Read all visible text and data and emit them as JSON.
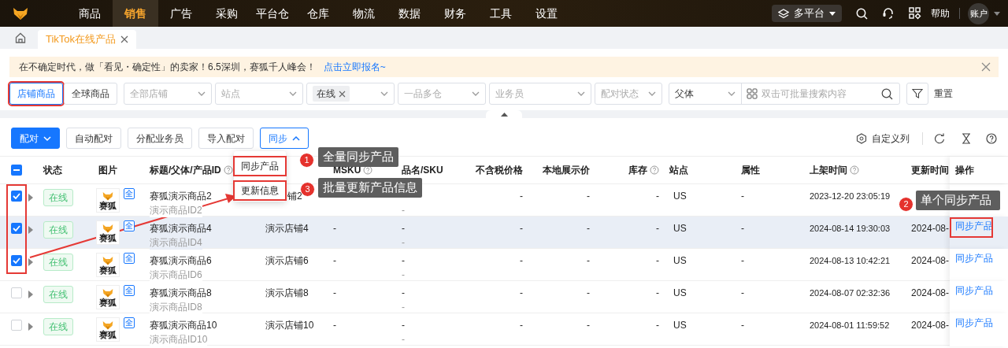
{
  "nav": {
    "items": [
      {
        "label": "商品",
        "selected": false
      },
      {
        "label": "销售",
        "selected": true
      },
      {
        "label": "广告",
        "selected": false
      },
      {
        "label": "采购",
        "selected": false
      },
      {
        "label": "平台仓",
        "selected": false
      },
      {
        "label": "仓库",
        "selected": false
      },
      {
        "label": "物流",
        "selected": false
      },
      {
        "label": "数据",
        "selected": false
      },
      {
        "label": "财务",
        "selected": false
      },
      {
        "label": "工具",
        "selected": false
      },
      {
        "label": "设置",
        "selected": false
      }
    ],
    "platform": "多平台",
    "help": "帮助",
    "account": "账户"
  },
  "tabs": [
    {
      "label": "TikTok在线产品",
      "selected": true
    }
  ],
  "banner": {
    "text": "在不确定时代，做「看见・确定性」的卖家！6.5深圳，赛狐千人峰会！",
    "link": "点击立即报名~"
  },
  "scope_buttons": [
    {
      "label": "店铺商品",
      "selected": true
    },
    {
      "label": "全球商品",
      "selected": false
    }
  ],
  "filters": [
    {
      "kind": "select",
      "placeholder": "全部店铺"
    },
    {
      "kind": "select",
      "placeholder": "站点"
    },
    {
      "kind": "tag",
      "tag": "在线"
    },
    {
      "kind": "select",
      "placeholder": "一品多仓"
    },
    {
      "kind": "select",
      "placeholder": "业务员"
    },
    {
      "kind": "select",
      "placeholder": "配对状态"
    },
    {
      "kind": "search",
      "value": "父体",
      "placeholder": "双击可批量搜索内容"
    }
  ],
  "reset": "重置",
  "toolbar": {
    "buttons": [
      {
        "label": "配对",
        "kind": "primary"
      },
      {
        "label": "自动配对",
        "kind": "plain"
      },
      {
        "label": "分配业务员",
        "kind": "plain"
      },
      {
        "label": "导入配对",
        "kind": "plain"
      },
      {
        "label": "同步",
        "kind": "open"
      }
    ],
    "custom_columns": "自定义列"
  },
  "sync_menu": [
    "同步产品",
    "更新信息"
  ],
  "table": {
    "select_all": {
      "indeterminate": true
    },
    "columns": [
      {
        "label": "状态"
      },
      {
        "label": "图片"
      },
      {
        "label": "标题/父体/产品ID",
        "help": true
      },
      {},
      {
        "label": "MSKU",
        "help": true
      },
      {
        "label": "品名/SKU"
      },
      {
        "label": "不含税价格"
      },
      {
        "label": "本地展示价"
      },
      {
        "label": "库存",
        "help": true
      },
      {
        "label": "站点"
      },
      {
        "label": "属性"
      },
      {
        "label": "上架时间",
        "help": true
      },
      {
        "label": "更新时间"
      },
      {
        "label": "操作"
      }
    ],
    "rows": [
      {
        "checked": true,
        "highlighted": false,
        "status": "在线",
        "thumb": "赛狐",
        "badge": "全",
        "title": "赛狐演示商品2",
        "product_id": "演示商品ID2",
        "store": "铺2",
        "store_cut": true,
        "sku": "-",
        "price": "-",
        "local_price": "-",
        "stock": "-",
        "site": "US",
        "attributes": "-",
        "listed": "2023-12-20 23:05:19"
      },
      {
        "checked": true,
        "highlighted": true,
        "status": "在线",
        "thumb": "赛狐",
        "badge": "全",
        "title": "赛狐演示商品4",
        "product_id": "演示商品ID4",
        "store": "演示店铺4",
        "msku": "-",
        "name": "-",
        "sku": "-",
        "price": "-",
        "local_price": "-",
        "stock": "-",
        "site": "US",
        "attributes": "-",
        "listed": "2024-08-14 19:30:03",
        "updated": "2024-08-",
        "action": "同步产品"
      },
      {
        "checked": true,
        "highlighted": false,
        "status": "在线",
        "thumb": "赛狐",
        "badge": "全",
        "title": "赛狐演示商品6",
        "product_id": "演示商品ID6",
        "store": "演示店铺6",
        "msku": "-",
        "name": "-",
        "sku": "-",
        "price": "-",
        "local_price": "-",
        "stock": "-",
        "site": "US",
        "attributes": "-",
        "listed": "2024-08-13 10:42:21",
        "updated": "2024-08-",
        "action": "同步产品"
      },
      {
        "checked": false,
        "highlighted": false,
        "status": "在线",
        "thumb": "赛狐",
        "badge": "全",
        "title": "赛狐演示商品8",
        "product_id": "演示商品ID8",
        "store": "演示店铺8",
        "msku": "-",
        "name": "-",
        "sku": "-",
        "price": "-",
        "local_price": "-",
        "stock": "-",
        "site": "US",
        "attributes": "-",
        "listed": "2024-08-07 02:32:36",
        "updated": "2024-08-",
        "action": "同步产品"
      },
      {
        "checked": false,
        "highlighted": false,
        "status": "在线",
        "thumb": "赛狐",
        "badge": "全",
        "title": "赛狐演示商品10",
        "product_id": "演示商品ID10",
        "store": "演示店铺10",
        "msku": "-",
        "name": "-",
        "sku": "-",
        "price": "-",
        "local_price": "-",
        "stock": "-",
        "site": "US",
        "attributes": "-",
        "listed": "2024-08-01 11:59:52",
        "updated": "2024-08-",
        "action": "同步产品"
      }
    ]
  },
  "annotations": [
    {
      "number": "1",
      "text": "全量同步产品"
    },
    {
      "number": "3",
      "text": "批量更新产品信息"
    },
    {
      "number": "2",
      "text": "单个同步产品"
    }
  ]
}
